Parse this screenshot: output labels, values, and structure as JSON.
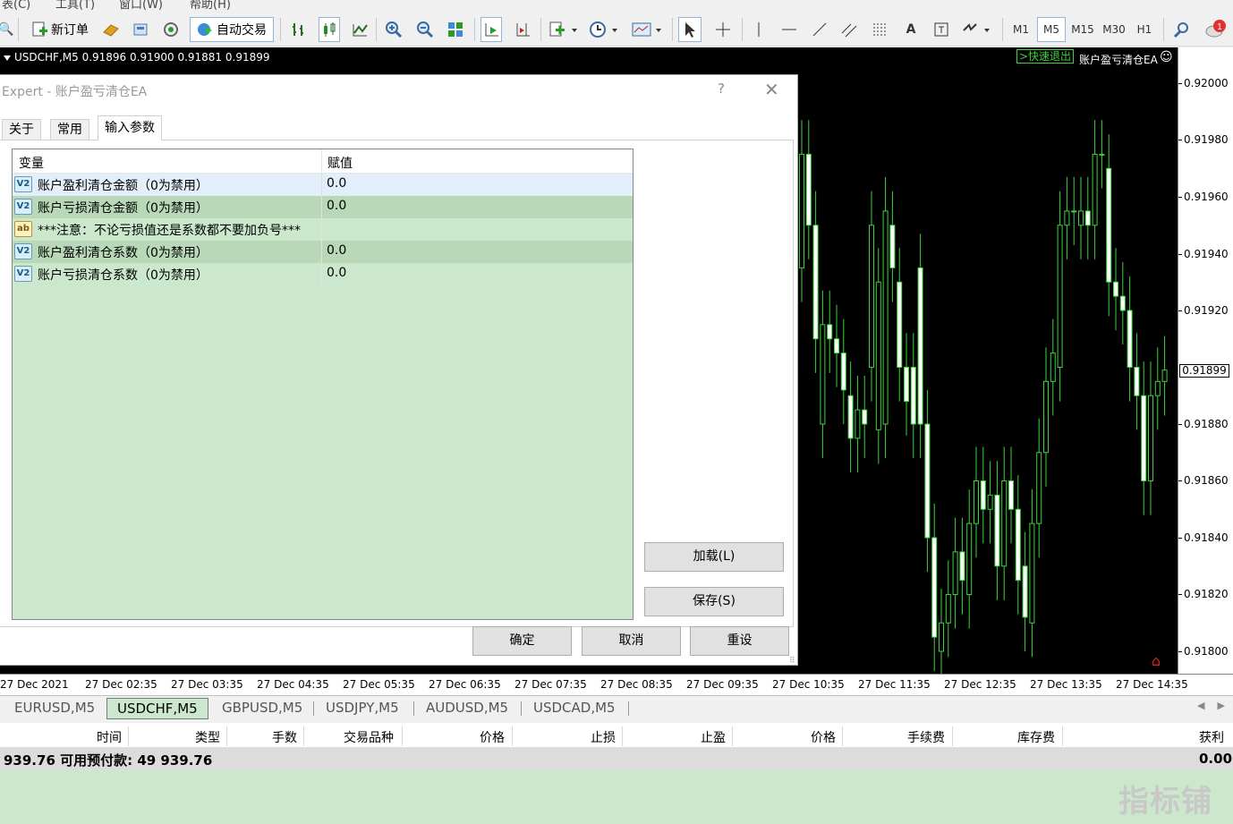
{
  "menubar": {
    "items": [
      "表(C)",
      "工具(T)",
      "窗口(W)",
      "帮助(H)"
    ]
  },
  "toolbar": {
    "new_order": "新订单",
    "auto_trade": "自动交易",
    "timeframes": [
      "M1",
      "M5",
      "M15",
      "M30",
      "H1"
    ],
    "active_timeframe": "M5",
    "notification_count": "1"
  },
  "chart": {
    "title": "USDCHF,M5  0.91896 0.91900 0.91881 0.91899",
    "quick_exit": ">快速退出",
    "ea_name": "账户盈亏清仓EA",
    "smiley": "☺",
    "current_price": "0.91899",
    "bull_color": "#3cd33c",
    "price_ticks": [
      "0.92000",
      "0.91980",
      "0.91960",
      "0.91940",
      "0.91920",
      "0.91880",
      "0.91860",
      "0.91840",
      "0.91820",
      "0.91800"
    ],
    "time_ticks": [
      "27 Dec 2021",
      "27 Dec 02:35",
      "27 Dec 03:35",
      "27 Dec 04:35",
      "27 Dec 05:35",
      "27 Dec 06:35",
      "27 Dec 07:35",
      "27 Dec 08:35",
      "27 Dec 09:35",
      "27 Dec 10:35",
      "27 Dec 11:35",
      "27 Dec 12:35",
      "27 Dec 13:35",
      "27 Dec 14:35"
    ]
  },
  "dialog": {
    "title": "Expert - 账户盈亏清仓EA",
    "help": "?",
    "close": "✕",
    "tabs": [
      "关于",
      "常用",
      "输入参数"
    ],
    "active_tab": "输入参数",
    "columns": {
      "variable": "变量",
      "value": "赋值"
    },
    "params": [
      {
        "icon": "V2",
        "name": "账户盈利清仓金额（0为禁用）",
        "value": "0.0"
      },
      {
        "icon": "V2",
        "name": "账户亏损清仓金额（0为禁用）",
        "value": "0.0"
      },
      {
        "icon": "ab",
        "name": "***注意：不论亏损值还是系数都不要加负号***",
        "value": ""
      },
      {
        "icon": "V2",
        "name": "账户盈利清仓系数（0为禁用）",
        "value": "0.0"
      },
      {
        "icon": "V2",
        "name": "账户亏损清仓系数（0为禁用）",
        "value": "0.0"
      }
    ],
    "load": "加载(L)",
    "save": "保存(S)",
    "ok": "确定",
    "cancel": "取消",
    "reset": "重设"
  },
  "symbol_tabs": [
    "EURUSD,M5",
    "USDCHF,M5",
    "GBPUSD,M5",
    "USDJPY,M5",
    "AUDUSD,M5",
    "USDCAD,M5"
  ],
  "active_symbol": "USDCHF,M5",
  "terminal": {
    "columns": [
      "时间",
      "类型",
      "手数",
      "交易品种",
      "价格",
      "止损",
      "止盈",
      "价格",
      "手续费",
      "库存费",
      "获利"
    ],
    "balance_text": "939.76  可用预付款: 49 939.76",
    "profit_total": "0.00"
  },
  "watermark": "指标铺",
  "chart_data": {
    "type": "candlestick",
    "symbol": "USDCHF",
    "timeframe": "M5",
    "ylim": [
      0.9179,
      0.9202
    ],
    "open": [
      0.91935,
      0.91975,
      0.9195,
      0.9188,
      0.91915,
      0.9191,
      0.91905,
      0.9189,
      0.91875,
      0.91885,
      0.919,
      0.91878,
      0.9188,
      0.9195,
      0.9193,
      0.919,
      0.919,
      0.91935,
      0.9188,
      0.9184,
      0.918,
      0.9181,
      0.9182,
      0.91835,
      0.9182,
      0.91845,
      0.9186,
      0.9185,
      0.91855,
      0.9183,
      0.9186,
      0.9185,
      0.9183,
      0.9181,
      0.91845,
      0.9187,
      0.91895,
      0.919,
      0.9195,
      0.91955,
      0.9195,
      0.91955,
      0.9195,
      0.91975,
      0.9197,
      0.9193,
      0.91925,
      0.9192,
      0.919,
      0.9189,
      0.9186,
      0.9189,
      0.91895
    ],
    "close": [
      0.91975,
      0.9195,
      0.9191,
      0.91915,
      0.9191,
      0.91905,
      0.91892,
      0.91875,
      0.91885,
      0.9188,
      0.9195,
      0.9193,
      0.91955,
      0.91935,
      0.919,
      0.91888,
      0.9188,
      0.9188,
      0.9184,
      0.91805,
      0.9181,
      0.9182,
      0.91835,
      0.91825,
      0.91845,
      0.9186,
      0.9185,
      0.91855,
      0.9183,
      0.9186,
      0.9185,
      0.91825,
      0.91812,
      0.91845,
      0.9187,
      0.91895,
      0.91905,
      0.9195,
      0.91955,
      0.91955,
      0.91955,
      0.9195,
      0.91975,
      0.91975,
      0.9193,
      0.91925,
      0.9192,
      0.919,
      0.9189,
      0.9186,
      0.9189,
      0.91895,
      0.91899
    ]
  }
}
